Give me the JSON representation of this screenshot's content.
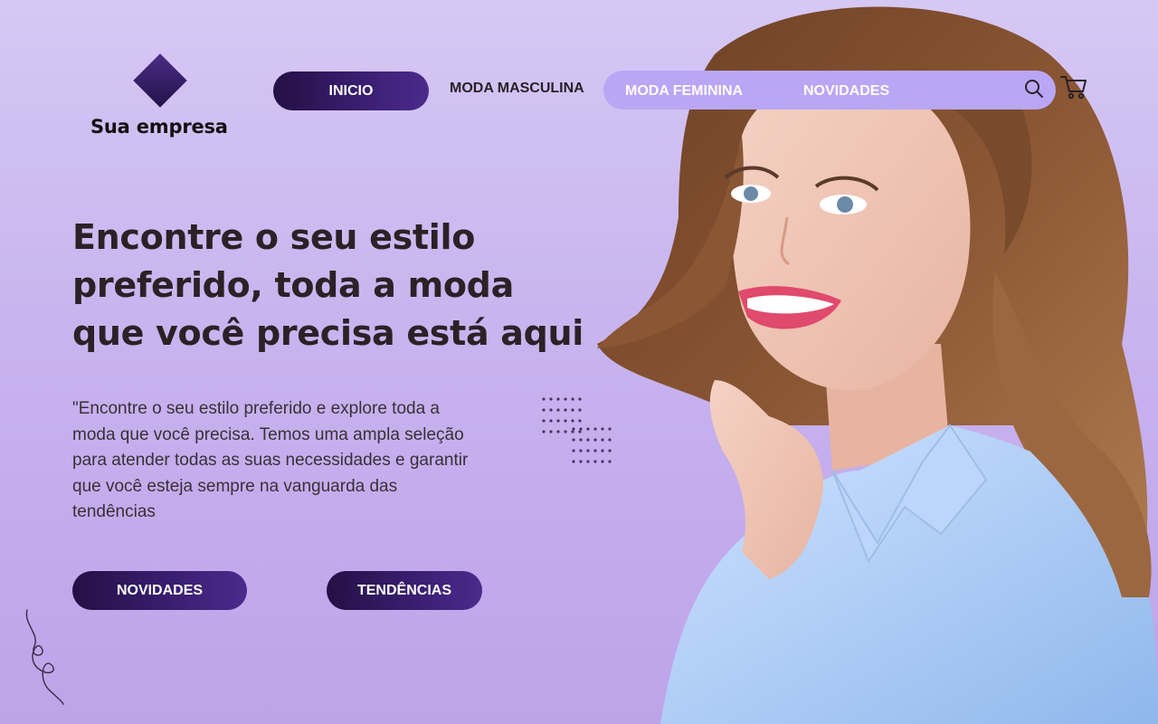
{
  "brand": {
    "name": "Sua empresa",
    "accent_color": "#2b1456",
    "background_color": "#cbb9ef",
    "nav_pill_color": "#b9a6f5"
  },
  "nav": {
    "items": [
      {
        "label": "INICIO",
        "active": true
      },
      {
        "label": "MODA MASCULINA",
        "active": false
      },
      {
        "label": "MODA FEMININA",
        "active": false
      },
      {
        "label": "NOVIDADES",
        "active": false
      }
    ],
    "icons": [
      "search-icon",
      "cart-icon"
    ]
  },
  "hero": {
    "headline_lines": [
      "Encontre o seu estilo",
      "preferido, toda a moda",
      "que você precisa está aqui"
    ],
    "description_lines": [
      "\"Encontre o seu estilo preferido e explore toda a",
      "moda que você precisa. Temos uma ampla seleção",
      "para atender todas as suas necessidades e garantir",
      "que você esteja sempre na vanguarda das",
      "tendências"
    ],
    "buttons": [
      {
        "label": "NOVIDADES"
      },
      {
        "label": "TENDÊNCIAS"
      }
    ]
  },
  "image": {
    "icon": "smiling-woman-photo"
  }
}
